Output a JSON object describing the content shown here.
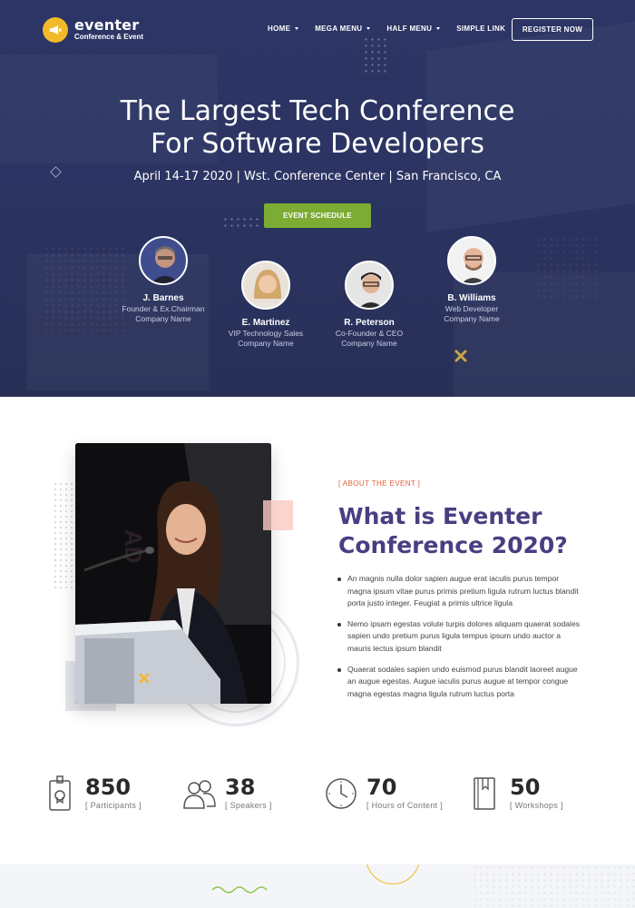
{
  "brand": {
    "name": "eventer",
    "tagline": "Conference & Event",
    "accent": "#f2b928"
  },
  "nav": {
    "items": [
      {
        "label": "HOME",
        "dropdown": true
      },
      {
        "label": "MEGA MENU",
        "dropdown": true
      },
      {
        "label": "HALF MENU",
        "dropdown": true
      },
      {
        "label": "SIMPLE LINK",
        "dropdown": false
      }
    ],
    "register_label": "REGISTER NOW"
  },
  "hero": {
    "title_line1": "The Largest Tech Conference",
    "title_line2": "For Software Developers",
    "subtitle": "April 14-17 2020 | Wst. Conference Center | San Francisco, CA",
    "cta_label": "EVENT SCHEDULE",
    "cta_color": "#7cac33",
    "background": "#2b3462"
  },
  "speakers": [
    {
      "name": "J. Barnes",
      "role": "Founder & Ex.Chairman",
      "company": "Company Name"
    },
    {
      "name": "E. Martinez",
      "role": "VIP Technology Sales",
      "company": "Company Name"
    },
    {
      "name": "R. Peterson",
      "role": "Co-Founder & CEO",
      "company": "Company Name"
    },
    {
      "name": "B. Williams",
      "role": "Web Developer",
      "company": "Company Name"
    }
  ],
  "about": {
    "kicker": "[ ABOUT THE EVENT ]",
    "title_line1": "What is Eventer",
    "title_line2": "Conference 2020?",
    "title_color": "#4a3e82",
    "kicker_color": "#e3613b",
    "points": [
      "An magnis nulla dolor sapien augue erat iaculis purus tempor magna ipsum vitae purus primis pretium ligula rutrum luctus blandit porta justo integer. Feugiat a primis ultrice ligula",
      "Nemo ipsam egestas volute turpis dolores aliquam quaerat sodales sapien undo pretium purus ligula tempus ipsum undo auctor a mauris lectus ipsum blandit",
      "Quaerat sodales sapien undo euismod purus blandit laoreet augue an augue egestas. Augue iaculis purus augue at tempor congue magna egestas magna ligula rutrum luctus porta"
    ]
  },
  "stats": [
    {
      "value": "850",
      "label": "[ Participants ]",
      "icon": "badge-icon"
    },
    {
      "value": "38",
      "label": "[ Speakers ]",
      "icon": "people-icon"
    },
    {
      "value": "70",
      "label": "[ Hours of Content ]",
      "icon": "clock-icon"
    },
    {
      "value": "50",
      "label": "[ Workshops ]",
      "icon": "book-icon"
    }
  ]
}
